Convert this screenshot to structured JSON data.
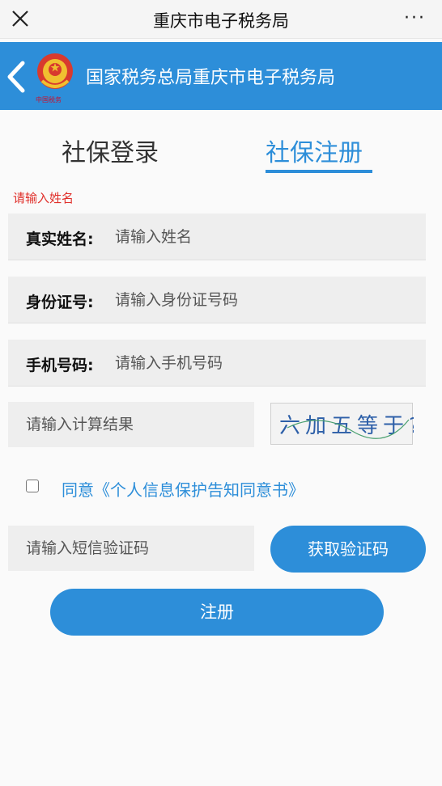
{
  "window": {
    "title": "重庆市电子税务局",
    "close_icon": "close-icon",
    "more_label": "···"
  },
  "header": {
    "org_name": "国家税务总局重庆市电子税务局",
    "back_icon": "chevron-left-icon",
    "emblem_icon": "national-emblem-icon",
    "emblem_text": "中国税务",
    "background_color": "#2d8ed9"
  },
  "tabs": [
    {
      "label": "社保登录",
      "active": false
    },
    {
      "label": "社保注册",
      "active": true
    }
  ],
  "error_message": "请输入姓名",
  "form": {
    "name": {
      "label": "真实姓名:",
      "placeholder": "请输入姓名",
      "value": ""
    },
    "id_number": {
      "label": "身份证号:",
      "placeholder": "请输入身份证号码",
      "value": ""
    },
    "phone": {
      "label": "手机号码:",
      "placeholder": "请输入手机号码",
      "value": ""
    },
    "calc_result": {
      "placeholder": "请输入计算结果",
      "value": ""
    },
    "captcha": {
      "text": "六加五等于?"
    },
    "agreement": {
      "checked": false,
      "label": "同意《个人信息保护告知同意书》"
    },
    "sms_code": {
      "placeholder": "请输入短信验证码",
      "value": ""
    },
    "get_code_label": "获取验证码",
    "submit_label": "注册"
  },
  "colors": {
    "accent": "#2d8ed9",
    "error": "#e0302b"
  }
}
